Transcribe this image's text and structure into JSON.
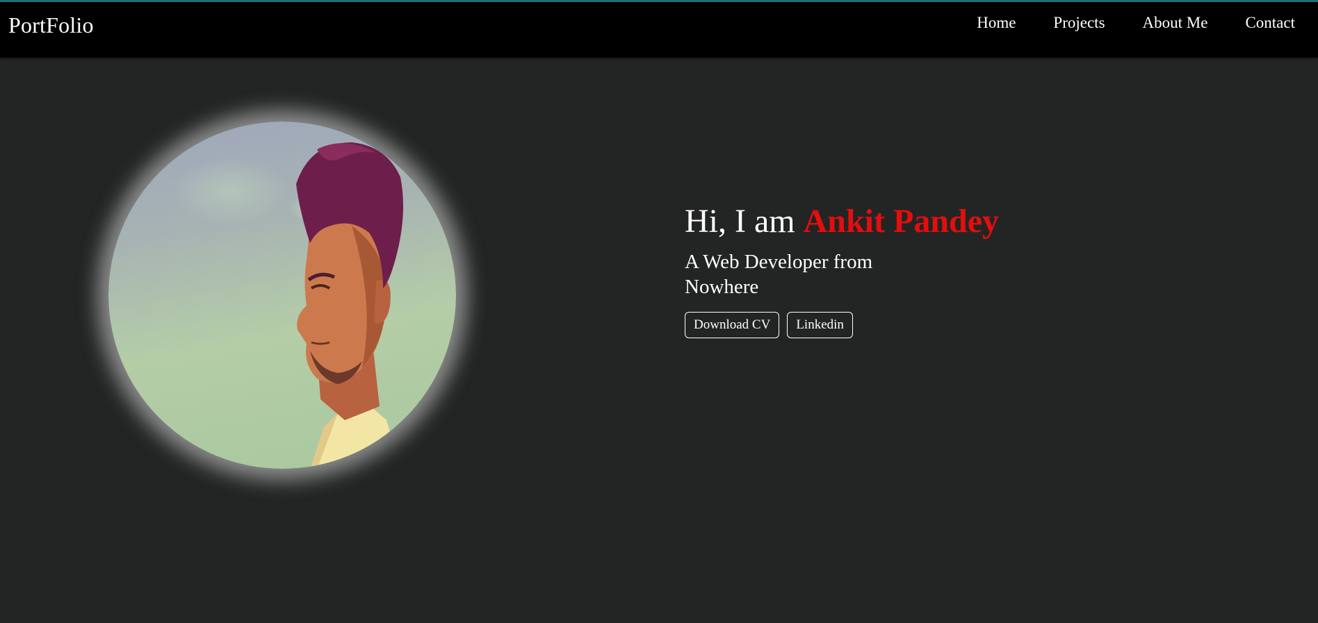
{
  "header": {
    "logo": "PortFolio",
    "nav": [
      "Home",
      "Projects",
      "About Me",
      "Contact"
    ]
  },
  "hero": {
    "greeting_prefix": "Hi, I am",
    "name": "Ankit Pandey",
    "tagline": "A Web Developer from Nowhere",
    "buttons": [
      "Download CV",
      "Linkedin"
    ]
  },
  "colors": {
    "background": "#232524",
    "header": "#000000",
    "accent_name": "#e30e0e",
    "top_border": "#1f6f73"
  }
}
